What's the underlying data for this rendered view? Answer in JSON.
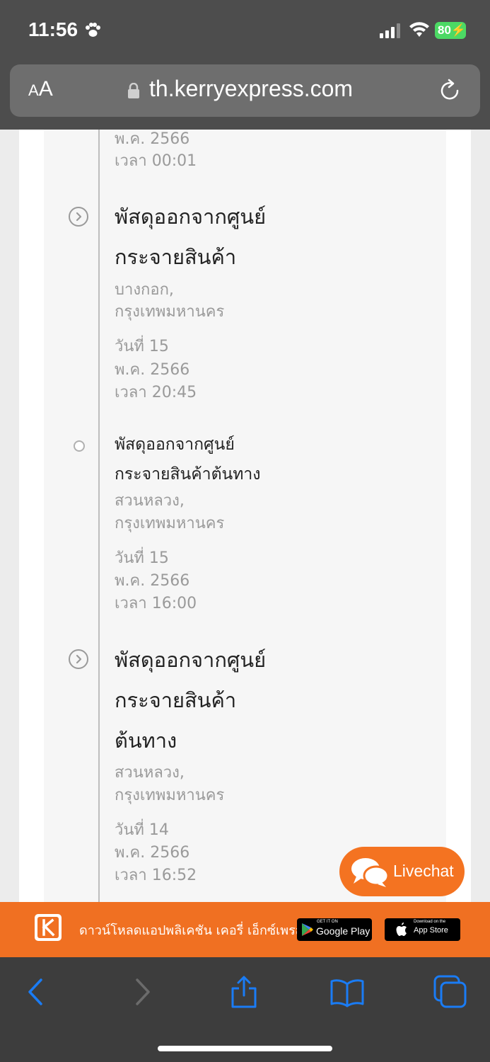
{
  "status_bar": {
    "time": "11:56",
    "battery": "80"
  },
  "browser": {
    "text_size_small": "A",
    "text_size_large": "A",
    "url": "th.kerryexpress.com"
  },
  "timeline": {
    "partial_item": {
      "month_year": "พ.ค. 2566",
      "time": "เวลา 00:01"
    },
    "items": [
      {
        "title_lines": [
          "พัสดุออกจากศูนย์",
          "กระจายสินค้า"
        ],
        "location_lines": [
          "บางกอก,",
          "กรุงเทพมหานคร"
        ],
        "day": "วันที่ 15",
        "month_year": "พ.ค. 2566",
        "time": "เวลา 20:45"
      },
      {
        "title_lines": [
          "พัสดุออกจากศูนย์",
          "กระจายสินค้าต้นทาง"
        ],
        "location_lines": [
          "สวนหลวง,",
          "กรุงเทพมหานคร"
        ],
        "day": "วันที่ 15",
        "month_year": "พ.ค. 2566",
        "time": "เวลา 16:00"
      },
      {
        "title_lines": [
          "พัสดุออกจากศูนย์",
          "กระจายสินค้า",
          "ต้นทาง"
        ],
        "location_lines": [
          "สวนหลวง,",
          "กรุงเทพมหานคร"
        ],
        "day": "วันที่ 14",
        "month_year": "พ.ค. 2566",
        "time": "เวลา 16:52"
      }
    ]
  },
  "livechat": {
    "label": "Livechat"
  },
  "app_banner": {
    "text": "ดาวน์โหลดแอปพลิเคชัน เคอรี่ เอ็กซ์เพรส",
    "google_play_small": "GET IT ON",
    "google_play_big": "Google Play",
    "app_store_small": "Download on the",
    "app_store_big": "App Store"
  },
  "colors": {
    "brand_orange": "#f47321",
    "battery_green": "#4cd964",
    "ios_blue": "#1a7cf5"
  }
}
